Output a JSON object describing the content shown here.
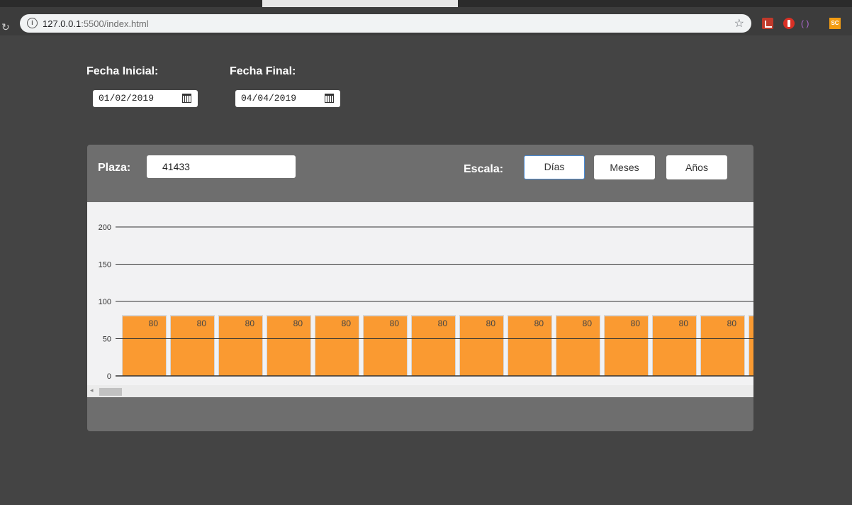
{
  "browser": {
    "url_host": "127.0.0.1",
    "url_path": ":5500/index.html"
  },
  "form": {
    "fecha_inicial_label": "Fecha Inicial:",
    "fecha_inicial_value": "01/02/2019",
    "fecha_final_label": "Fecha Final:",
    "fecha_final_value": "04/04/2019"
  },
  "panel": {
    "plaza_label": "Plaza:",
    "plaza_value": "41433",
    "escala_label": "Escala:",
    "scale_buttons": [
      "Días",
      "Meses",
      "Años"
    ],
    "active_scale": "Días"
  },
  "colors": {
    "bar": "#fa9a31",
    "panel": "#6e6e6e",
    "background": "#444444",
    "active_border": "#4a8cd6"
  },
  "chart_data": {
    "type": "bar",
    "ylim": [
      0,
      200
    ],
    "yticks": [
      0,
      50,
      100,
      150,
      200
    ],
    "values": [
      80,
      80,
      80,
      80,
      80,
      80,
      80,
      80,
      80,
      80,
      80,
      80,
      80,
      80
    ],
    "data_labels": [
      "80",
      "80",
      "80",
      "80",
      "80",
      "80",
      "80",
      "80",
      "80",
      "80",
      "80",
      "80",
      "80",
      ""
    ],
    "grid": true,
    "scrollable": true
  }
}
